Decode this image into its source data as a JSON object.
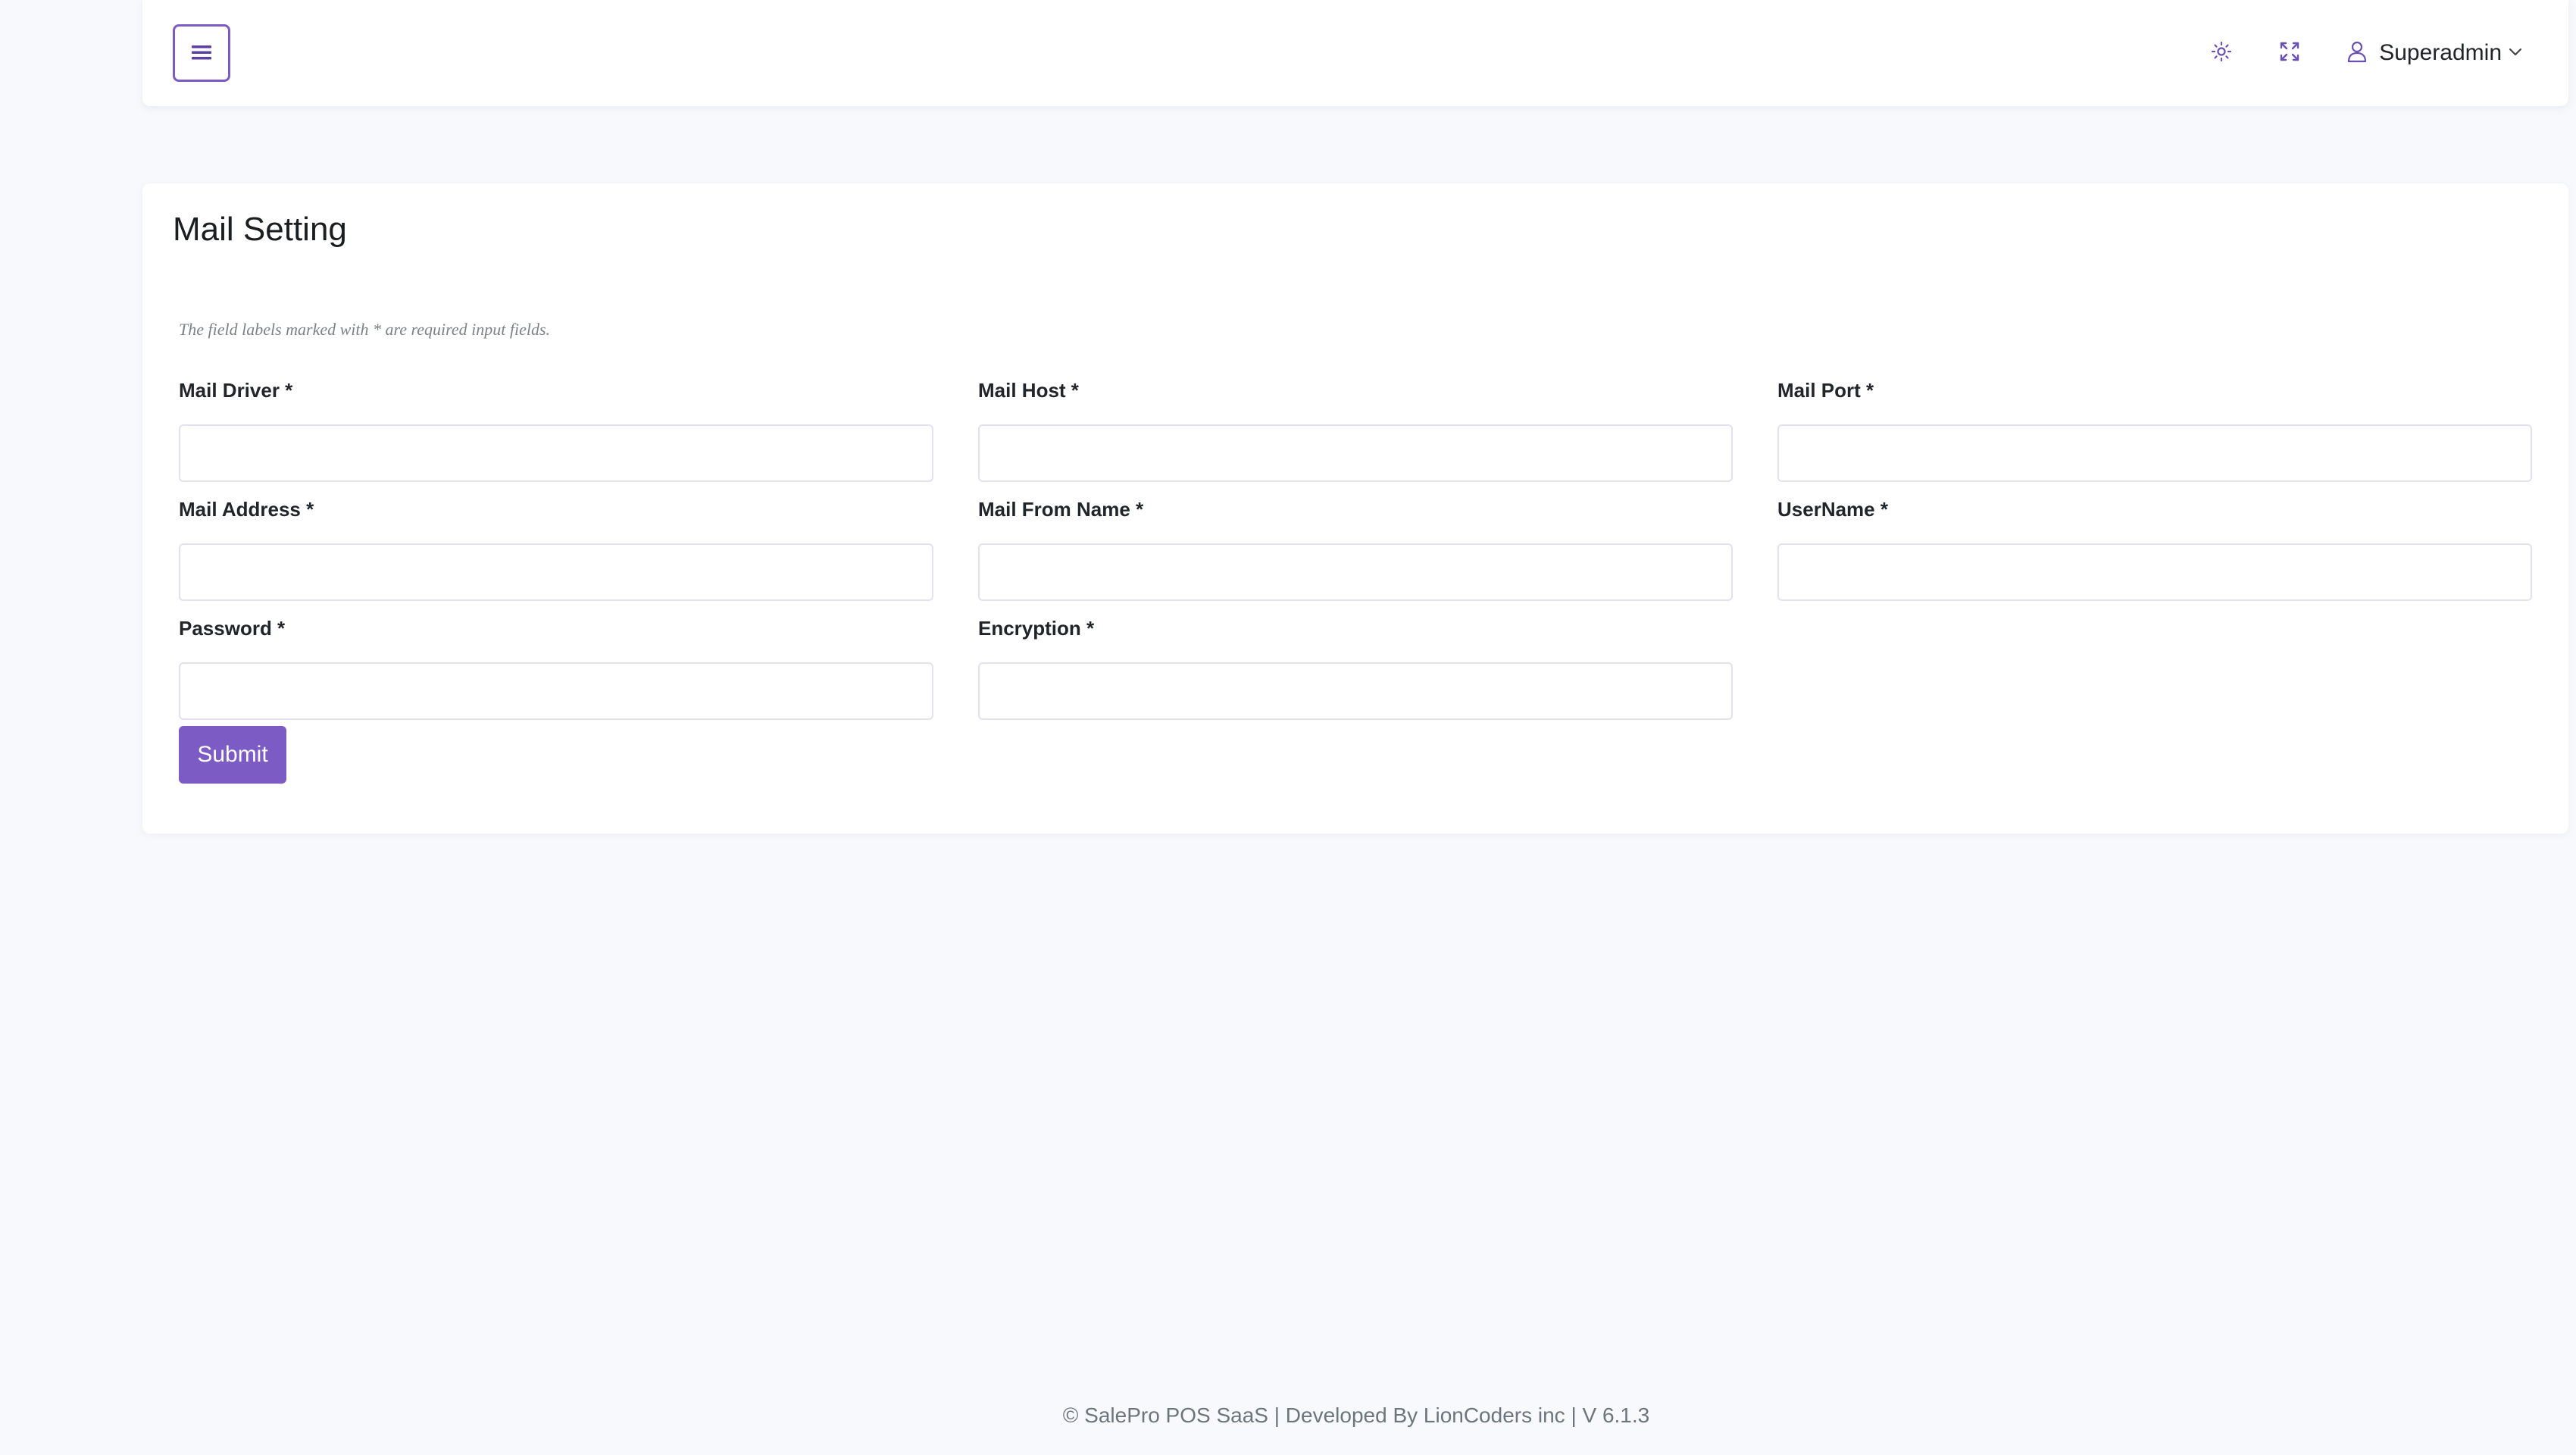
{
  "header": {
    "user_name": "Superadmin",
    "icons": {
      "menu": "hamburger-menu-icon",
      "brightness": "sun-icon",
      "fullscreen": "expand-icon",
      "user": "user-icon",
      "dropdown": "chevron-down-icon"
    }
  },
  "page": {
    "title": "Mail Setting",
    "note": "The field labels marked with * are required input fields."
  },
  "form": {
    "mail_driver": {
      "label": "Mail Driver *",
      "value": ""
    },
    "mail_host": {
      "label": "Mail Host *",
      "value": ""
    },
    "mail_port": {
      "label": "Mail Port *",
      "value": ""
    },
    "mail_address": {
      "label": "Mail Address *",
      "value": ""
    },
    "mail_from_name": {
      "label": "Mail From Name *",
      "value": ""
    },
    "username": {
      "label": "UserName *",
      "value": ""
    },
    "password": {
      "label": "Password *",
      "value": ""
    },
    "encryption": {
      "label": "Encryption *",
      "value": ""
    },
    "submit_label": "Submit"
  },
  "footer": {
    "text": "© SalePro POS SaaS | Developed By LionCoders inc | V 6.1.3"
  },
  "colors": {
    "accent": "#7c5cc4",
    "page_background": "#f8f9fc",
    "card_background": "#ffffff",
    "input_border": "#e3e1ef"
  }
}
